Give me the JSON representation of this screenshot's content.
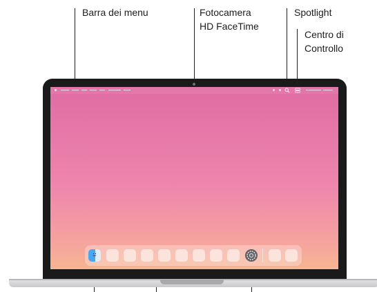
{
  "labels": {
    "menu_bar": "Barra dei menu",
    "camera_line1": "Fotocamera",
    "camera_line2": "HD FaceTime",
    "spotlight": "Spotlight",
    "control_center_line1": "Centro di",
    "control_center_line2": "Controllo"
  },
  "colors": {
    "text": "#1d1d1f",
    "wallpaper_top": "#e06ca3",
    "wallpaper_bottom": "#f7b592",
    "bezel": "#1a1a1a"
  },
  "icons": {
    "finder": "finder-icon",
    "settings": "gear-icon",
    "spotlight": "search-icon",
    "control_center": "control-center-icon"
  }
}
